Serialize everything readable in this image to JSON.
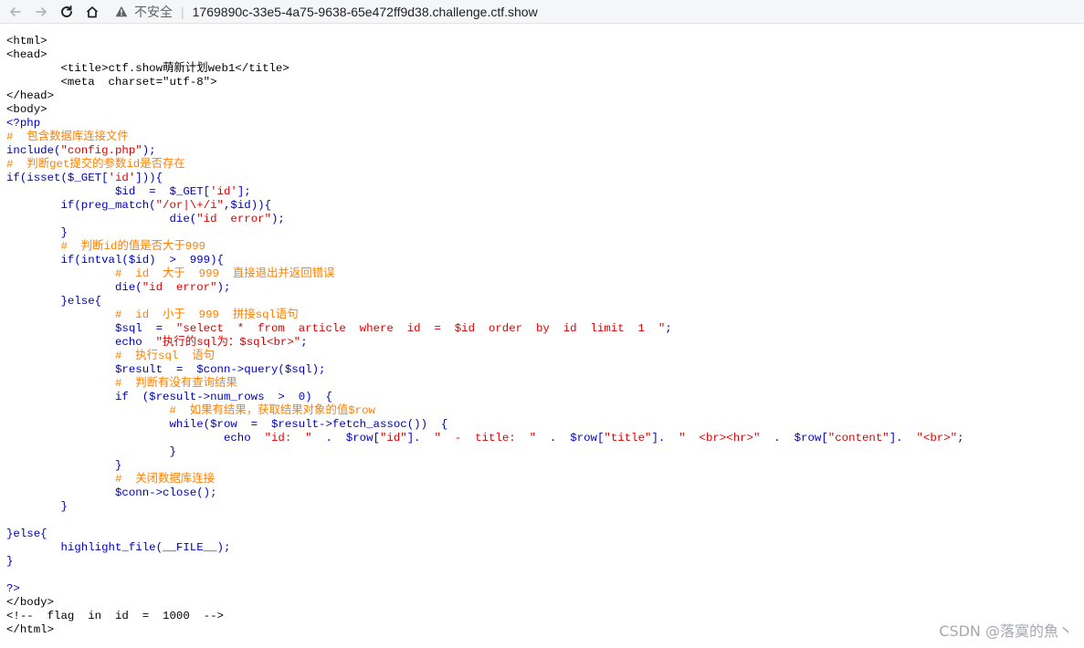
{
  "browser": {
    "insecure_label": "不安全",
    "url": "1769890c-33e5-4a75-9638-65e472ff9d38.challenge.ctf.show",
    "icons": [
      "back-arrow-icon",
      "forward-arrow-icon",
      "reload-icon",
      "home-icon",
      "warning-icon"
    ]
  },
  "source_lines": [
    [
      [
        "html",
        "<html>"
      ]
    ],
    [
      [
        "html",
        "<head>"
      ]
    ],
    [
      [
        "html",
        "        <title>ctf.show萌新计划web1</title>"
      ]
    ],
    [
      [
        "html",
        "        <meta  charset=\"utf-8\">"
      ]
    ],
    [
      [
        "html",
        "</head>"
      ]
    ],
    [
      [
        "html",
        "<body>"
      ]
    ],
    [
      [
        "kw",
        "<?php"
      ]
    ],
    [
      [
        "cm",
        "#  包含数据库连接文件"
      ]
    ],
    [
      [
        "kw",
        "include("
      ],
      [
        "str",
        "\"config.php\""
      ],
      [
        "kw",
        ");"
      ]
    ],
    [
      [
        "cm",
        "#  判断get提交的参数id是否存在"
      ]
    ],
    [
      [
        "kw",
        "if(isset($_GET["
      ],
      [
        "str",
        "'id'"
      ],
      [
        "kw",
        "])){"
      ]
    ],
    [
      [
        "kw",
        "                $id  =  $_GET["
      ],
      [
        "str",
        "'id'"
      ],
      [
        "kw",
        "];"
      ]
    ],
    [
      [
        "kw",
        "        if(preg_match("
      ],
      [
        "str",
        "\"/or|\\+/i\""
      ],
      [
        "kw",
        ",$id)){"
      ]
    ],
    [
      [
        "kw",
        "                        die("
      ],
      [
        "str",
        "\"id  error\""
      ],
      [
        "kw",
        ");"
      ]
    ],
    [
      [
        "kw",
        "        }"
      ]
    ],
    [
      [
        "cm",
        "        #  判断id的值是否大于999"
      ]
    ],
    [
      [
        "kw",
        "        if(intval($id)  >  999){"
      ]
    ],
    [
      [
        "cm",
        "                #  id  大于  999  直接退出并返回错误"
      ]
    ],
    [
      [
        "kw",
        "                die("
      ],
      [
        "str",
        "\"id  error\""
      ],
      [
        "kw",
        ");"
      ]
    ],
    [
      [
        "kw",
        "        }else{"
      ]
    ],
    [
      [
        "cm",
        "                #  id  小于  999  拼接sql语句"
      ]
    ],
    [
      [
        "kw",
        "                $sql  =  "
      ],
      [
        "str",
        "\"select  *  from  article  where  id  =  $id  order  by  id  limit  1  \""
      ],
      [
        "kw",
        ";"
      ]
    ],
    [
      [
        "kw",
        "                echo  "
      ],
      [
        "str",
        "\"执行的sql为：$sql<br>\""
      ],
      [
        "kw",
        ";"
      ]
    ],
    [
      [
        "cm",
        "                #  执行sql  语句"
      ]
    ],
    [
      [
        "kw",
        "                $result  =  $conn->query($sql);"
      ]
    ],
    [
      [
        "cm",
        "                #  判断有没有查询结果"
      ]
    ],
    [
      [
        "kw",
        "                if  ($result->num_rows  >  0)  {"
      ]
    ],
    [
      [
        "cm",
        "                        #  如果有结果，获取结果对象的值$row"
      ]
    ],
    [
      [
        "kw",
        "                        while($row  =  $result->fetch_assoc())  {"
      ]
    ],
    [
      [
        "kw",
        "                                echo  "
      ],
      [
        "str",
        "\"id:  \""
      ],
      [
        "kw",
        "  .  $row["
      ],
      [
        "str",
        "\"id\""
      ],
      [
        "kw",
        "].  "
      ],
      [
        "str",
        "\"  -  title:  \""
      ],
      [
        "kw",
        "  .  $row["
      ],
      [
        "str",
        "\"title\""
      ],
      [
        "kw",
        "].  "
      ],
      [
        "str",
        "\"  <br><hr>\""
      ],
      [
        "kw",
        "  .  $row["
      ],
      [
        "str",
        "\"content\""
      ],
      [
        "kw",
        "].  "
      ],
      [
        "str",
        "\"<br>\""
      ],
      [
        "kw",
        ";"
      ]
    ],
    [
      [
        "kw",
        "                        }"
      ]
    ],
    [
      [
        "kw",
        "                }"
      ]
    ],
    [
      [
        "cm",
        "                #  关闭数据库连接"
      ]
    ],
    [
      [
        "kw",
        "                $conn->close();"
      ]
    ],
    [
      [
        "kw",
        "        }"
      ]
    ],
    [
      [
        "kw",
        ""
      ]
    ],
    [
      [
        "kw",
        "}else{"
      ]
    ],
    [
      [
        "kw",
        "        highlight_file(__FILE__);"
      ]
    ],
    [
      [
        "kw",
        "}"
      ]
    ],
    [
      [
        "kw",
        ""
      ]
    ],
    [
      [
        "kw",
        "?>"
      ]
    ],
    [
      [
        "html",
        "</body>"
      ]
    ],
    [
      [
        "html",
        "<!--  flag  in  id  =  1000  -->"
      ]
    ],
    [
      [
        "html",
        "</html>"
      ]
    ]
  ],
  "watermark": "CSDN @落寞的魚丶"
}
